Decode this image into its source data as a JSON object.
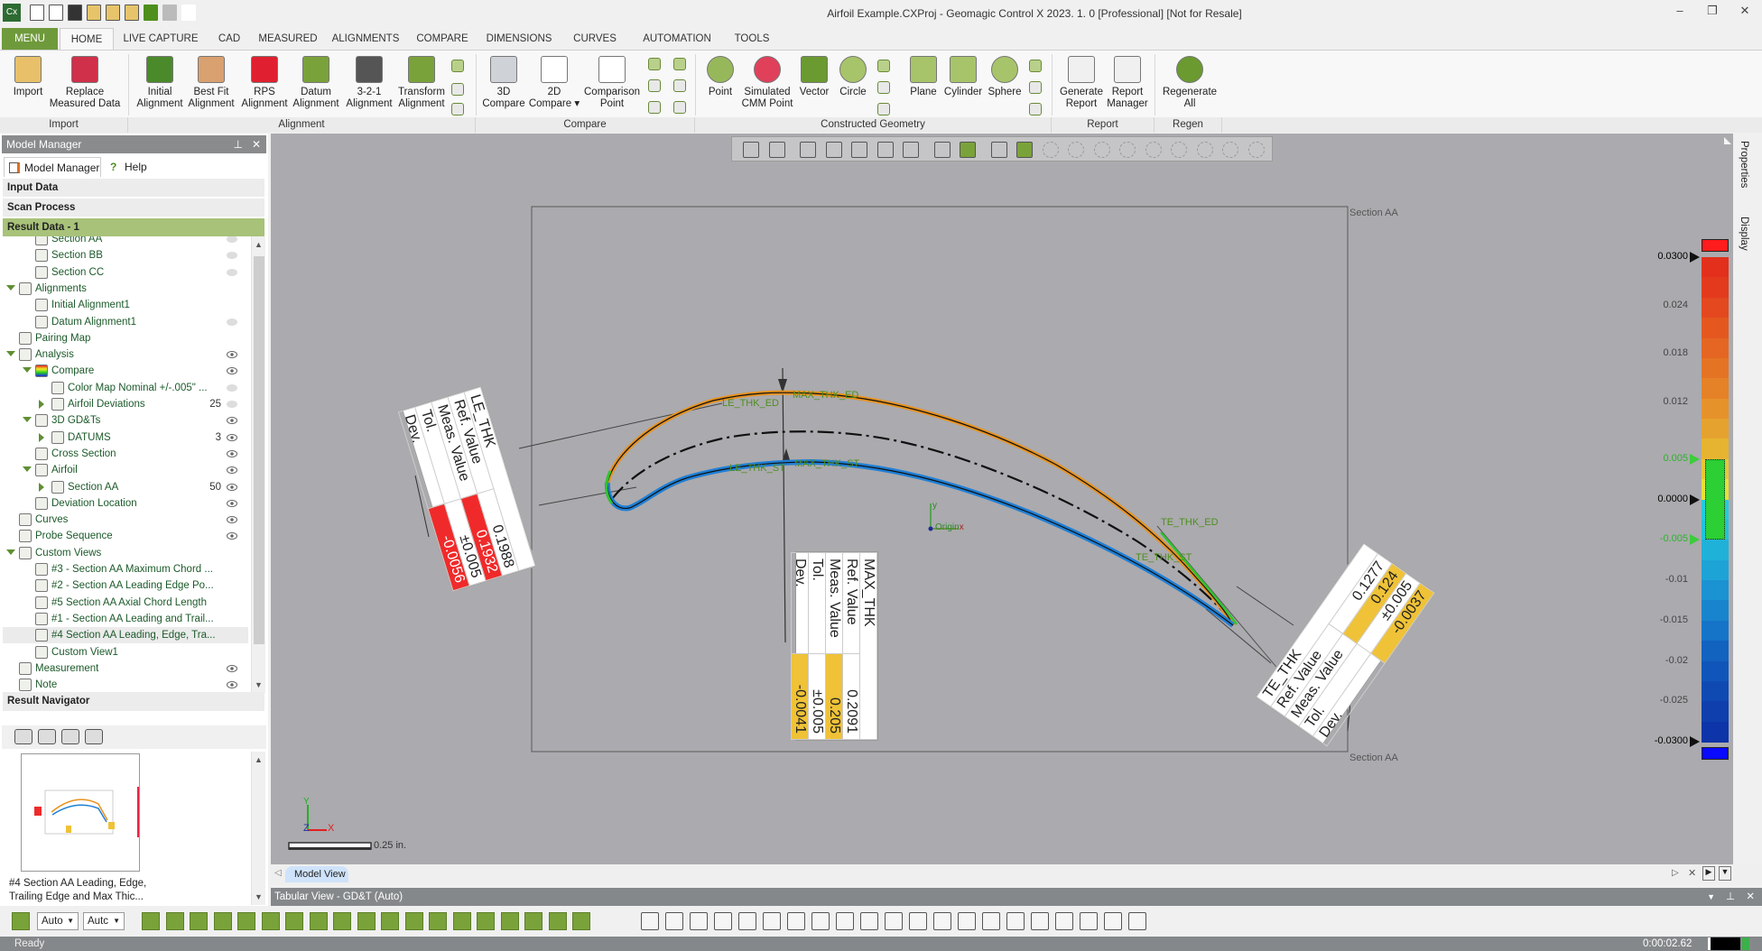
{
  "app": {
    "title": "Airfoil Example.CXProj - Geomagic Control X 2023. 1. 0 [Professional] [Not for Resale]",
    "logo": "Cx",
    "window_controls": [
      "minimize",
      "restore",
      "close"
    ],
    "quick_access_icons": [
      "new-icon",
      "import-icon",
      "save-icon",
      "open-icon",
      "export-icon",
      "settings-icon",
      "undo-icon",
      "redo-icon",
      "customize-icon"
    ]
  },
  "menu_tabs": [
    {
      "label": "MENU",
      "state": "menu"
    },
    {
      "label": "HOME",
      "state": "active"
    },
    {
      "label": "LIVE CAPTURE"
    },
    {
      "label": "CAD"
    },
    {
      "label": "MEASURED"
    },
    {
      "label": "ALIGNMENTS"
    },
    {
      "label": "COMPARE"
    },
    {
      "label": "DIMENSIONS"
    },
    {
      "label": "CURVES"
    },
    {
      "label": "AUTOMATION"
    },
    {
      "label": "TOOLS"
    }
  ],
  "ribbon": {
    "groups": [
      {
        "label": "Import"
      },
      {
        "label": "Alignment"
      },
      {
        "label": "Compare"
      },
      {
        "label": "Constructed Geometry"
      },
      {
        "label": "Report"
      },
      {
        "label": "Regen"
      }
    ],
    "buttons": [
      {
        "label": "Import",
        "icon": "folder-import-icon"
      },
      {
        "label": "Replace\nMeasured Data",
        "icon": "replace-data-icon"
      },
      {
        "label": "Initial\nAlignment",
        "icon": "initial-alignment-icon"
      },
      {
        "label": "Best Fit\nAlignment",
        "icon": "best-fit-icon"
      },
      {
        "label": "RPS\nAlignment",
        "icon": "rps-flag-icon"
      },
      {
        "label": "Datum\nAlignment",
        "icon": "datum-alignment-icon"
      },
      {
        "label": "3-2-1\nAlignment",
        "icon": "321-alignment-icon"
      },
      {
        "label": "Transform\nAlignment",
        "icon": "transform-icon"
      },
      {
        "label": "3D\nCompare",
        "icon": "3d-compare-icon"
      },
      {
        "label": "2D\nCompare ▾",
        "icon": "2d-compare-icon"
      },
      {
        "label": "Comparison\nPoint",
        "icon": "crosshair-icon"
      },
      {
        "label": "Point",
        "icon": "point-icon"
      },
      {
        "label": "Simulated\nCMM Point",
        "icon": "cmm-point-icon"
      },
      {
        "label": "Vector",
        "icon": "vector-icon"
      },
      {
        "label": "Circle",
        "icon": "circle-icon"
      },
      {
        "label": "Plane",
        "icon": "plane-icon"
      },
      {
        "label": "Cylinder",
        "icon": "cylinder-icon"
      },
      {
        "label": "Sphere",
        "icon": "sphere-icon"
      },
      {
        "label": "Generate\nReport",
        "icon": "generate-report-icon"
      },
      {
        "label": "Report\nManager",
        "icon": "report-manager-icon"
      },
      {
        "label": "Regenerate\nAll",
        "icon": "regenerate-icon"
      }
    ]
  },
  "left_panel": {
    "header": "Model Manager",
    "tabs": [
      {
        "label": "Model Manager"
      },
      {
        "label": "Help"
      }
    ],
    "sections": [
      "Input Data",
      "Scan Process",
      "Result Data - 1"
    ],
    "tree": [
      {
        "label": "Section AA",
        "indent": 2,
        "exp": "",
        "icon": "section-icon",
        "vis": "dot"
      },
      {
        "label": "Section BB",
        "indent": 2,
        "exp": "",
        "icon": "section-icon",
        "vis": "dot"
      },
      {
        "label": "Section CC",
        "indent": 2,
        "exp": "",
        "icon": "section-icon",
        "vis": "dot"
      },
      {
        "label": "Alignments",
        "indent": 1,
        "exp": "open",
        "icon": "alignments-icon",
        "vis": ""
      },
      {
        "label": "Initial Alignment1",
        "indent": 2,
        "exp": "",
        "icon": "initial-alignment-icon",
        "vis": ""
      },
      {
        "label": "Datum Alignment1",
        "indent": 2,
        "exp": "",
        "icon": "datum-alignment-icon",
        "vis": "dot"
      },
      {
        "label": "Pairing Map",
        "indent": 1,
        "exp": "",
        "icon": "pairing-map-icon",
        "vis": ""
      },
      {
        "label": "Analysis",
        "indent": 1,
        "exp": "open",
        "icon": "analysis-icon",
        "vis": "eye"
      },
      {
        "label": "Compare",
        "indent": 2,
        "exp": "open",
        "icon": "compare-icon",
        "vis": "eye"
      },
      {
        "label": "Color Map Nominal +/-.005\" ...",
        "indent": 3,
        "exp": "",
        "icon": "color-map-icon",
        "vis": "dot"
      },
      {
        "label": "Airfoil Deviations",
        "indent": 3,
        "exp": "closed",
        "icon": "deviation-icon",
        "count": "25",
        "vis": "dot"
      },
      {
        "label": "3D GD&Ts",
        "indent": 2,
        "exp": "open",
        "icon": "gdt-icon",
        "vis": "eye"
      },
      {
        "label": "DATUMS",
        "indent": 3,
        "exp": "closed",
        "icon": "datum-icon",
        "count": "3",
        "vis": "eye"
      },
      {
        "label": "Cross Section",
        "indent": 2,
        "exp": "",
        "icon": "cross-section-icon",
        "vis": "eye"
      },
      {
        "label": "Airfoil",
        "indent": 2,
        "exp": "open",
        "icon": "airfoil-icon",
        "vis": "eye"
      },
      {
        "label": "Section AA",
        "indent": 3,
        "exp": "closed",
        "icon": "airfoil-icon",
        "count": "50",
        "vis": "eye"
      },
      {
        "label": "Deviation Location",
        "indent": 2,
        "exp": "",
        "icon": "deviation-location-icon",
        "vis": "eye"
      },
      {
        "label": "Curves",
        "indent": 1,
        "exp": "",
        "icon": "curves-icon",
        "vis": "eye"
      },
      {
        "label": "Probe Sequence",
        "indent": 1,
        "exp": "",
        "icon": "probe-sequence-icon",
        "vis": "eye"
      },
      {
        "label": "Custom Views",
        "indent": 1,
        "exp": "open",
        "icon": "camera-icon",
        "vis": ""
      },
      {
        "label": "#3 - Section AA Maximum Chord ...",
        "indent": 2,
        "exp": "",
        "icon": "camera-icon",
        "vis": ""
      },
      {
        "label": "#2 - Section AA Leading Edge Po...",
        "indent": 2,
        "exp": "",
        "icon": "camera-icon",
        "vis": ""
      },
      {
        "label": "#5 Section AA Axial Chord Length",
        "indent": 2,
        "exp": "",
        "icon": "camera-icon",
        "vis": ""
      },
      {
        "label": "#1 - Section AA Leading and Trail...",
        "indent": 2,
        "exp": "",
        "icon": "camera-icon",
        "vis": ""
      },
      {
        "label": "#4 Section AA Leading, Edge, Tra...",
        "indent": 2,
        "exp": "",
        "icon": "camera-icon",
        "vis": "",
        "selected": true
      },
      {
        "label": "Custom View1",
        "indent": 2,
        "exp": "",
        "icon": "camera-icon",
        "vis": ""
      },
      {
        "label": "Measurement",
        "indent": 1,
        "exp": "",
        "icon": "measurement-icon",
        "vis": "eye"
      },
      {
        "label": "Note",
        "indent": 1,
        "exp": "",
        "icon": "note-icon",
        "vis": "eye"
      }
    ],
    "result_navigator": {
      "header": "Result Navigator",
      "tools": [
        "add-view-icon",
        "update-view-icon",
        "show-view-icon",
        "swap-view-icon"
      ],
      "thumbnail_caption": "#4 Section AA Leading, Edge,\nTrailing Edge and Max Thic..."
    }
  },
  "viewport": {
    "section_label_top": "Section AA",
    "section_label_bottom": "Section AA",
    "view_toolbar_icons": [
      "view-orientation-icon",
      "cube-view-icon",
      "section-view-icon",
      "rotate-left-icon",
      "rotate-right-icon",
      "split-view-icon",
      "normal-up-icon",
      "layout-icon",
      "compare-layout-icon",
      "line-select-icon",
      "rect-select-icon",
      "circle-select-icon",
      "circle-select2-icon",
      "lasso-icon",
      "paint-select-icon",
      "brush-select-icon",
      "flood-select-icon",
      "extend-select-icon",
      "depth-select-icon",
      "visible-only-icon"
    ],
    "point_labels": {
      "le_ed": "LE_THK_ED",
      "le_st": "LE_THK_ST",
      "max_ed": "MAX_THK_ED",
      "max_st": "MAX_THK_ST",
      "te_ed": "TE_THK_ED",
      "te_st": "TE_THK_ST"
    },
    "origin": {
      "label": "Origin",
      "x": "x",
      "y": "y",
      "z": "z"
    },
    "triad": {
      "x": "X",
      "y": "Y",
      "z": "Z"
    },
    "scale_bar": "0.25 in.",
    "colors": {
      "suction": "#e8921e",
      "pressure": "#1f7fd6",
      "in_tol": "#2fc42f"
    },
    "callouts": [
      {
        "id": "le",
        "title": "LE_THK",
        "rows": [
          {
            "label": "Ref. Value",
            "value": "0.1988",
            "fill": ""
          },
          {
            "label": "Meas. Value",
            "value": "0.1932",
            "fill": "#f02a2a"
          },
          {
            "label": "Tol.",
            "value": "±0.005",
            "fill": ""
          },
          {
            "label": "Dev.",
            "value": "-0.0056",
            "fill": "#f02a2a"
          }
        ]
      },
      {
        "id": "max",
        "title": "MAX_THK",
        "rows": [
          {
            "label": "Ref. Value",
            "value": "0.2091",
            "fill": ""
          },
          {
            "label": "Meas. Value",
            "value": "0.205",
            "fill": "#efc237"
          },
          {
            "label": "Tol.",
            "value": "±0.005",
            "fill": ""
          },
          {
            "label": "Dev.",
            "value": "-0.0041",
            "fill": "#efc237"
          }
        ]
      },
      {
        "id": "te",
        "title": "TE_THK",
        "rows": [
          {
            "label": "Ref. Value",
            "value": "0.1277",
            "fill": ""
          },
          {
            "label": "Meas. Value",
            "value": "0.124",
            "fill": "#efc237"
          },
          {
            "label": "Tol.",
            "value": "±0.005",
            "fill": ""
          },
          {
            "label": "Dev.",
            "value": "-0.0037",
            "fill": "#efc237"
          }
        ]
      }
    ],
    "color_bar": {
      "max": 0.03,
      "min": -0.03,
      "tol_upper": 0.005,
      "tol_lower": -0.005,
      "labels": [
        {
          "text": "0.0300",
          "value": 0.03,
          "kind": "limit"
        },
        {
          "text": "0.024",
          "value": 0.024
        },
        {
          "text": "0.018",
          "value": 0.018
        },
        {
          "text": "0.012",
          "value": 0.012
        },
        {
          "text": "0.005",
          "value": 0.005,
          "kind": "tol"
        },
        {
          "text": "0.0000",
          "value": 0.0,
          "kind": "limit"
        },
        {
          "text": "-0.005",
          "value": -0.005,
          "kind": "tol"
        },
        {
          "text": "-0.01",
          "value": -0.01
        },
        {
          "text": "-0.015",
          "value": -0.015
        },
        {
          "text": "-0.02",
          "value": -0.02
        },
        {
          "text": "-0.025",
          "value": -0.025
        },
        {
          "text": "-0.0300",
          "value": -0.03,
          "kind": "limit"
        }
      ],
      "bands": [
        "#e2301c",
        "#e33a1d",
        "#e3481f",
        "#e45820",
        "#e46622",
        "#e57324",
        "#e58227",
        "#e6922b",
        "#e6a22e",
        "#e6b431",
        "#e8c734",
        "#eadf36",
        "#22cbe0",
        "#22c2dd",
        "#20b1d9",
        "#1ea3d6",
        "#1b92d2",
        "#1884cd",
        "#1574c8",
        "#1262c0",
        "#1055b9",
        "#0f4ab3",
        "#0e3fad",
        "#0d34a8"
      ],
      "above_color": "#ff1c1c",
      "below_color": "#0a0aff",
      "tol_color": "#2ccf34"
    }
  },
  "right_sidebar": {
    "tabs": [
      "Properties",
      "Display"
    ]
  },
  "model_view_tab": "Model View",
  "tabular_view": "Tabular View - GD&T (Auto)",
  "bottom_toolbar": {
    "select1": "Auto",
    "select2": "Autc"
  },
  "status": {
    "text": "Ready",
    "timer": "0:00:02.62"
  }
}
